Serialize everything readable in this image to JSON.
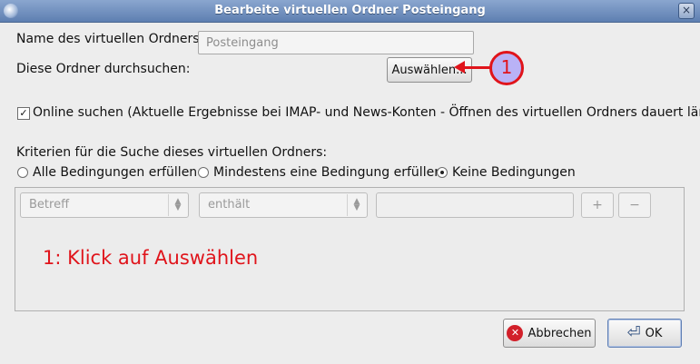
{
  "window": {
    "title": "Bearbeite virtuellen Ordner Posteingang",
    "close_glyph": "×"
  },
  "form": {
    "name_label": "Name des virtuellen Ordners:",
    "name_value": "Posteingang",
    "search_folders_label": "Diese Ordner durchsuchen:",
    "select_button": "Auswählen...",
    "online_search_checked": true,
    "online_search_label": "Online suchen (Aktuelle Ergebnisse bei IMAP- und News-Konten - Öffnen des virtuellen Ordners dauert länger)",
    "criteria_label": "Kriterien für die Suche dieses virtuellen Ordners:",
    "radio_all": "Alle Bedingungen erfüllen",
    "radio_any": "Mindestens eine Bedingung erfüllen",
    "radio_none": "Keine Bedingungen",
    "selected_radio": "radio_none"
  },
  "criteria_row": {
    "field_select": "Betreff",
    "operator_select": "enthält",
    "value": "",
    "add_glyph": "+",
    "remove_glyph": "−"
  },
  "annotation": {
    "callout_number": "1",
    "text": "1: Klick auf Auswählen",
    "color": "#e0141b"
  },
  "buttons": {
    "cancel": "Abbrechen",
    "ok": "OK"
  },
  "icons": {
    "app": "thunderbird-icon",
    "cancel": "cancel-icon",
    "ok": "ok-enter-icon"
  }
}
